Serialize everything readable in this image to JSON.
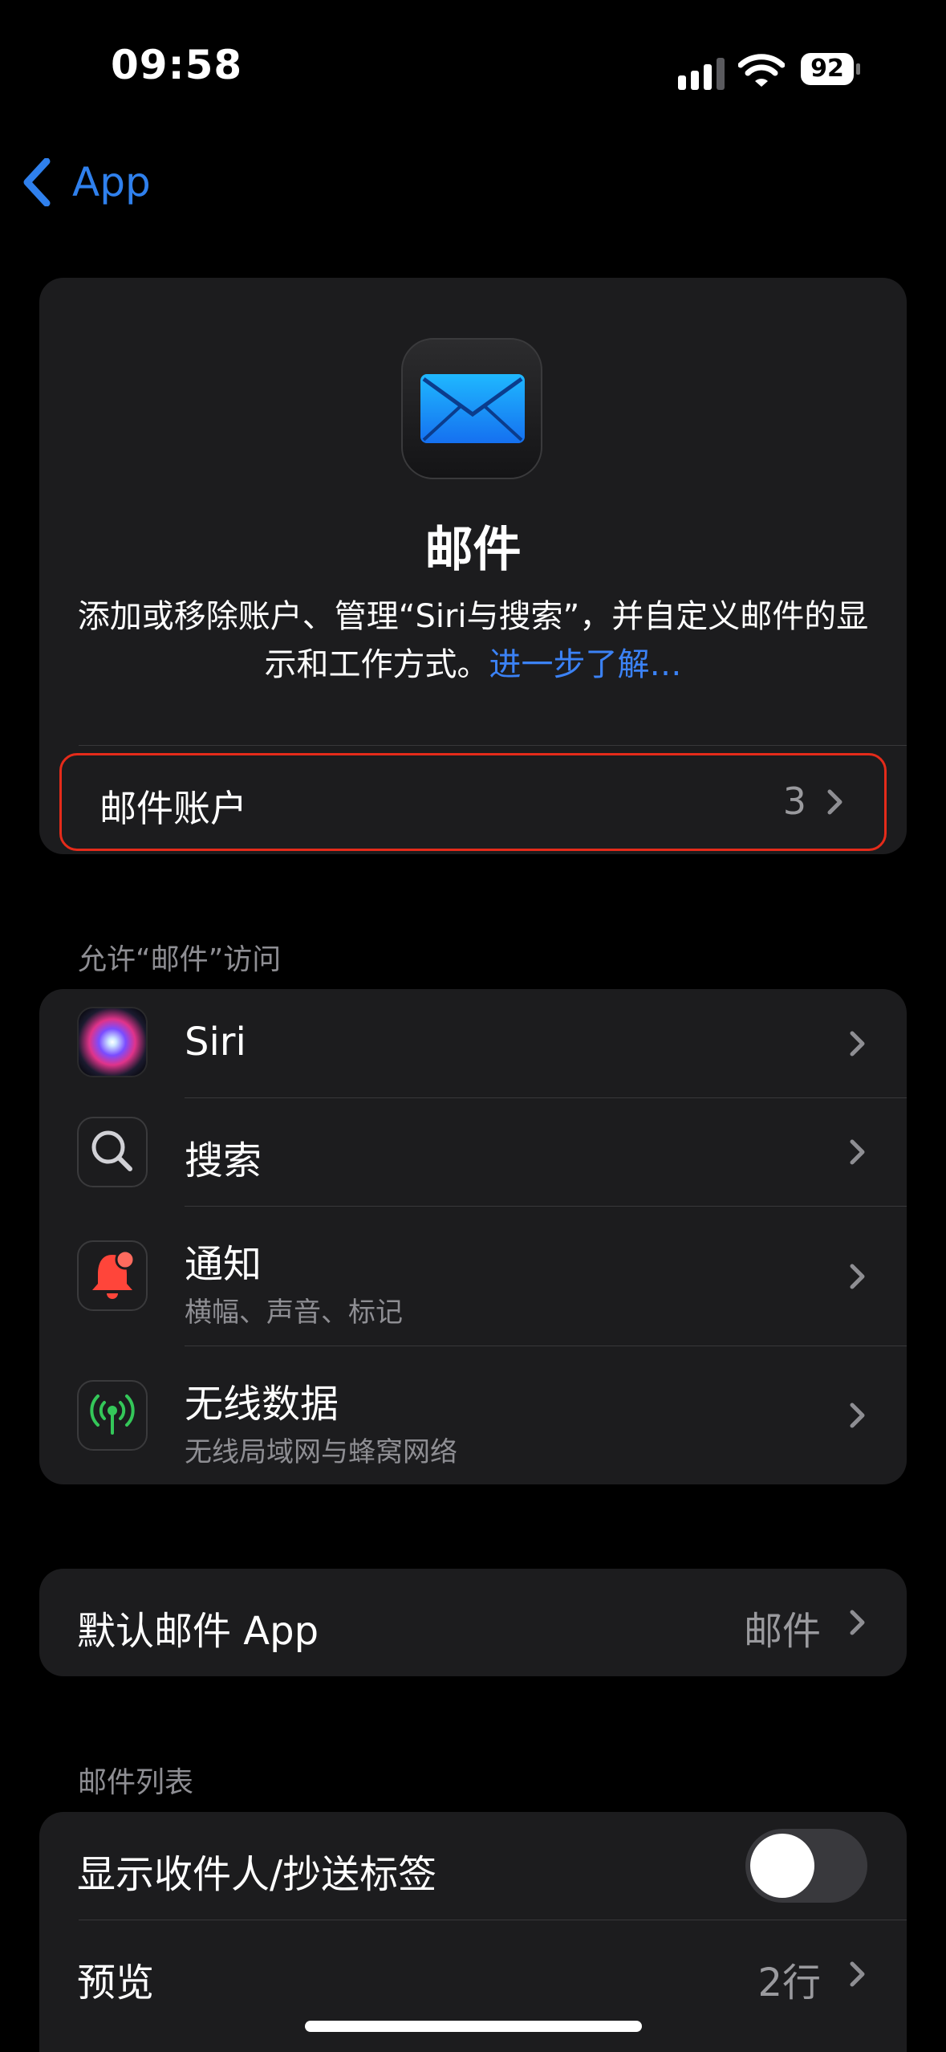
{
  "status_bar": {
    "time": "09:58",
    "battery": "92"
  },
  "nav": {
    "back_label": "App"
  },
  "header": {
    "app_name": "邮件",
    "description": "添加或移除账户、管理“Siri与搜索”，并自定义邮件的显示和工作方式。",
    "learn_more": "进一步了解…"
  },
  "mail_accounts": {
    "label": "邮件账户",
    "value": "3"
  },
  "access_section": {
    "header": "允许“邮件”访问",
    "items": [
      {
        "title": "Siri",
        "subtitle": "",
        "icon": "siri-icon"
      },
      {
        "title": "搜索",
        "subtitle": "",
        "icon": "search-icon"
      },
      {
        "title": "通知",
        "subtitle": "横幅、声音、标记",
        "icon": "notification-bell-icon"
      },
      {
        "title": "无线数据",
        "subtitle": "无线局域网与蜂窝网络",
        "icon": "wireless-data-icon"
      }
    ]
  },
  "default_app": {
    "label": "默认邮件 App",
    "value": "邮件"
  },
  "mail_list": {
    "header": "邮件列表",
    "show_to_cc": {
      "label": "显示收件人/抄送标签",
      "enabled": false
    },
    "preview": {
      "label": "预览",
      "value": "2行"
    }
  },
  "colors": {
    "accent": "#2f80ed",
    "highlight": "#e52b1a",
    "card": "#1c1c1e"
  }
}
